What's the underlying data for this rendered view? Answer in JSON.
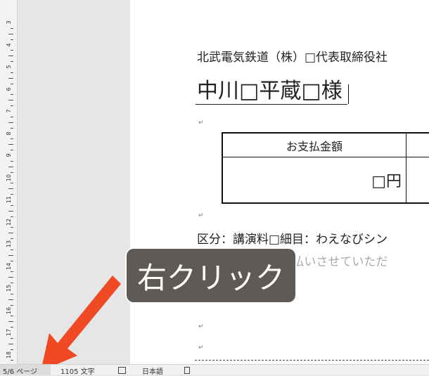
{
  "ruler": {
    "numbers": [
      "3",
      "4",
      "5",
      "6",
      "7",
      "8",
      "9",
      "10",
      "11",
      "12",
      "13",
      "14",
      "15",
      "16",
      "17",
      "18"
    ]
  },
  "document": {
    "addressee": "北武電気鉄道（株）□代表取締役社",
    "name": "中川□平蔵□様",
    "paragraph_mark": "↵",
    "table": {
      "header": "お支払金額",
      "amount": "□円"
    },
    "section_line": "区分：講演料□細目：わえなびシン",
    "note_line": "上記の通り、お支払いさせていただ"
  },
  "callout": {
    "label": "右クリック"
  },
  "statusbar": {
    "page_count": "5/6 ページ",
    "word_count": "1105 文字",
    "language": "日本語"
  },
  "colors": {
    "arrow": "#f04a24",
    "callout_bg": "#5f5a55",
    "page_bg": "#ffffff",
    "workspace_bg": "#e6e6e6"
  }
}
